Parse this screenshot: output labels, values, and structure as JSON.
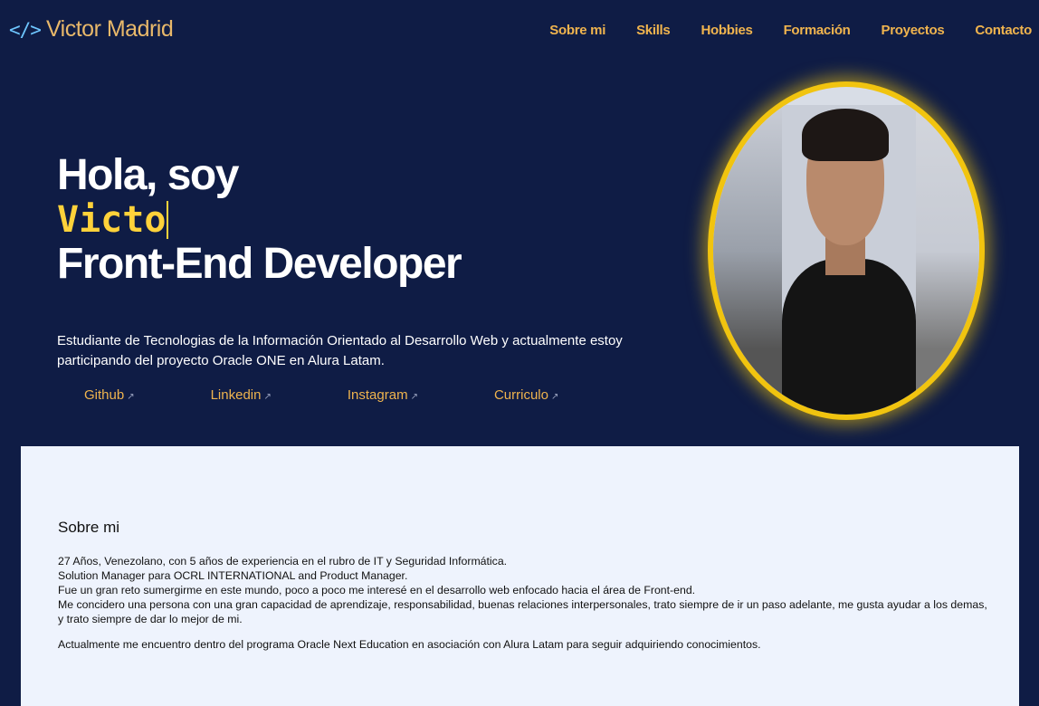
{
  "header": {
    "brand_icon": "</>",
    "brand_name": "Victor Madrid",
    "nav": [
      "Sobre mi",
      "Skills",
      "Hobbies",
      "Formación",
      "Proyectos",
      "Contacto"
    ]
  },
  "hero": {
    "line1": "Hola, soy",
    "typed": "Victo",
    "line3": "Front-End Developer",
    "intro": "Estudiante de Tecnologias de la Información Orientado al Desarrollo Web y actualmente estoy participando del proyecto Oracle ONE en Alura Latam.",
    "links": [
      "Github",
      "Linkedin",
      "Instagram",
      "Curriculo"
    ],
    "link_arrow": "↗"
  },
  "about": {
    "title": "Sobre mi",
    "lines": [
      "27 Años, Venezolano, con 5 años de experiencia en el rubro de IT y Seguridad Informática.",
      "Solution Manager para OCRL INTERNATIONAL and Product Manager.",
      "Fue un gran reto sumergirme en este mundo, poco a poco me interesé en el desarrollo web enfocado hacia el área de Front-end.",
      "Me concidero una persona con una gran capacidad de aprendizaje, responsabilidad, buenas relaciones interpersonales, trato siempre de ir un paso adelante, me gusta ayudar a los demas, y trato siempre de dar lo mejor de mi."
    ],
    "paragraph2": "Actualmente me encuentro dentro del programa Oracle Next Education en asociación con Alura Latam para seguir adquiriendo conocimientos."
  },
  "colors": {
    "background": "#0f1c45",
    "accent": "#f0b44e",
    "typed": "#ffd23a",
    "ring": "#f1c40f",
    "section_bg": "#eef3fd"
  }
}
